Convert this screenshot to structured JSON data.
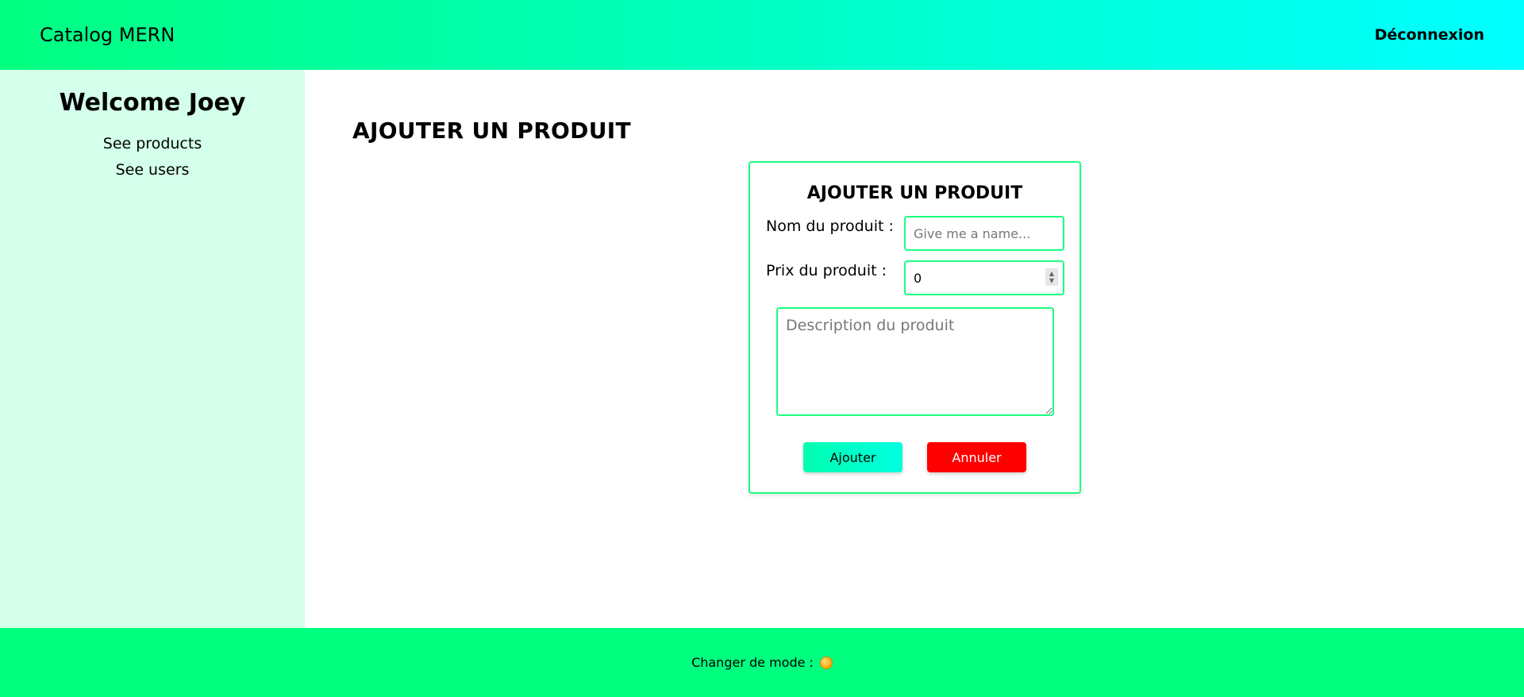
{
  "header": {
    "brand": "Catalog MERN",
    "logout_label": "Déconnexion"
  },
  "sidebar": {
    "welcome": "Welcome Joey",
    "items": [
      {
        "label": "See products"
      },
      {
        "label": "See users"
      }
    ]
  },
  "main": {
    "page_title": "AJOUTER UN PRODUIT",
    "form": {
      "title": "AJOUTER UN PRODUIT",
      "name_label": "Nom du produit :",
      "name_placeholder": "Give me a name...",
      "name_value": "",
      "price_label": "Prix du produit :",
      "price_value": "0",
      "description_placeholder": "Description du produit",
      "description_value": "",
      "submit_label": "Ajouter",
      "cancel_label": "Annuler"
    }
  },
  "footer": {
    "mode_label": "Changer de mode :",
    "mode_icon": "sun-icon"
  },
  "colors": {
    "accent": "#00ff7f",
    "header_end": "#00ffff",
    "sidebar_bg": "#d4ffea",
    "cancel": "#ff0000"
  }
}
